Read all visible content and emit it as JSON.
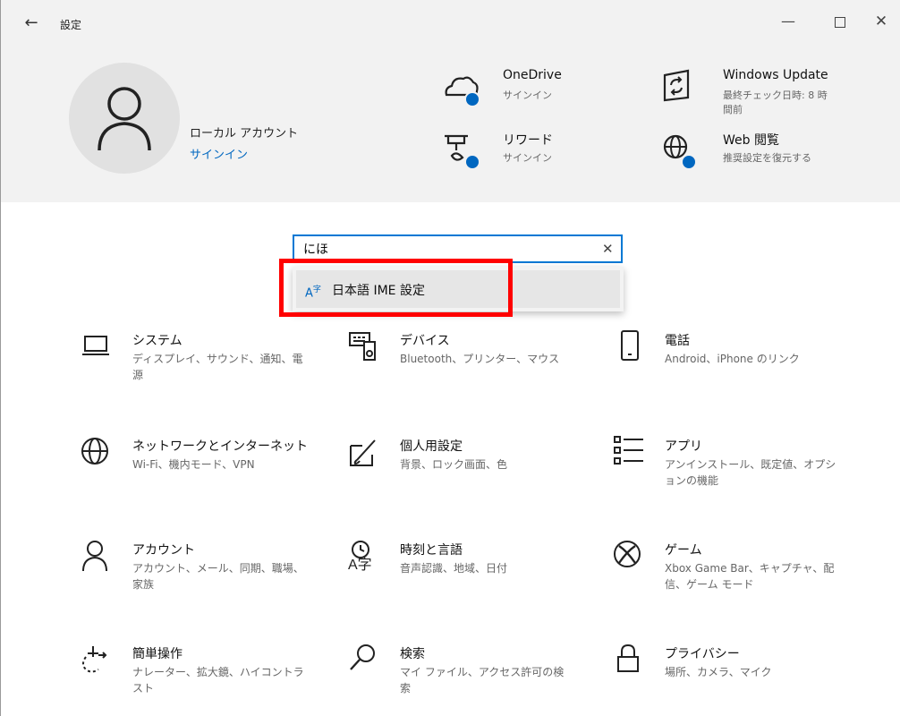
{
  "window": {
    "title": "設定"
  },
  "colors": {
    "accent": "#0067c0",
    "header_bg": "#f2f2f2",
    "highlight": "#ff0000"
  },
  "account": {
    "name": "ローカル アカウント",
    "signin": "サインイン"
  },
  "header_items": [
    {
      "title": "OneDrive",
      "subtitle": "サインイン",
      "icon": "onedrive-icon"
    },
    {
      "title": "Windows Update",
      "subtitle": "最終チェック日時: 8 時間前",
      "icon": "windows-update-icon"
    },
    {
      "title": "リワード",
      "subtitle": "サインイン",
      "icon": "rewards-icon"
    },
    {
      "title": "Web 閲覧",
      "subtitle": "推奨設定を復元する",
      "icon": "web-browsing-icon"
    }
  ],
  "search": {
    "value": "にほ",
    "clear_icon": "close-icon"
  },
  "suggestions": [
    {
      "label": "日本語 IME 設定",
      "icon": "ime-icon"
    }
  ],
  "categories": [
    {
      "title": "システム",
      "subtitle": "ディスプレイ、サウンド、通知、電源",
      "icon": "laptop-icon"
    },
    {
      "title": "デバイス",
      "subtitle": "Bluetooth、プリンター、マウス",
      "icon": "devices-icon"
    },
    {
      "title": "電話",
      "subtitle": "Android、iPhone のリンク",
      "icon": "phone-icon"
    },
    {
      "title": "ネットワークとインターネット",
      "subtitle": "Wi-Fi、機内モード、VPN",
      "icon": "globe-icon"
    },
    {
      "title": "個人用設定",
      "subtitle": "背景、ロック画面、色",
      "icon": "personalization-icon"
    },
    {
      "title": "アプリ",
      "subtitle": "アンインストール、既定値、オプションの機能",
      "icon": "apps-icon"
    },
    {
      "title": "アカウント",
      "subtitle": "アカウント、メール、同期、職場、家族",
      "icon": "person-icon"
    },
    {
      "title": "時刻と言語",
      "subtitle": "音声認識、地域、日付",
      "icon": "time-language-icon"
    },
    {
      "title": "ゲーム",
      "subtitle": "Xbox Game Bar、キャプチャ、配信、ゲーム モード",
      "icon": "xbox-icon"
    },
    {
      "title": "簡単操作",
      "subtitle": "ナレーター、拡大鏡、ハイコントラスト",
      "icon": "ease-of-access-icon"
    },
    {
      "title": "検索",
      "subtitle": "マイ ファイル、アクセス許可の検索",
      "icon": "search-icon"
    },
    {
      "title": "プライバシー",
      "subtitle": "場所、カメラ、マイク",
      "icon": "lock-icon"
    }
  ]
}
